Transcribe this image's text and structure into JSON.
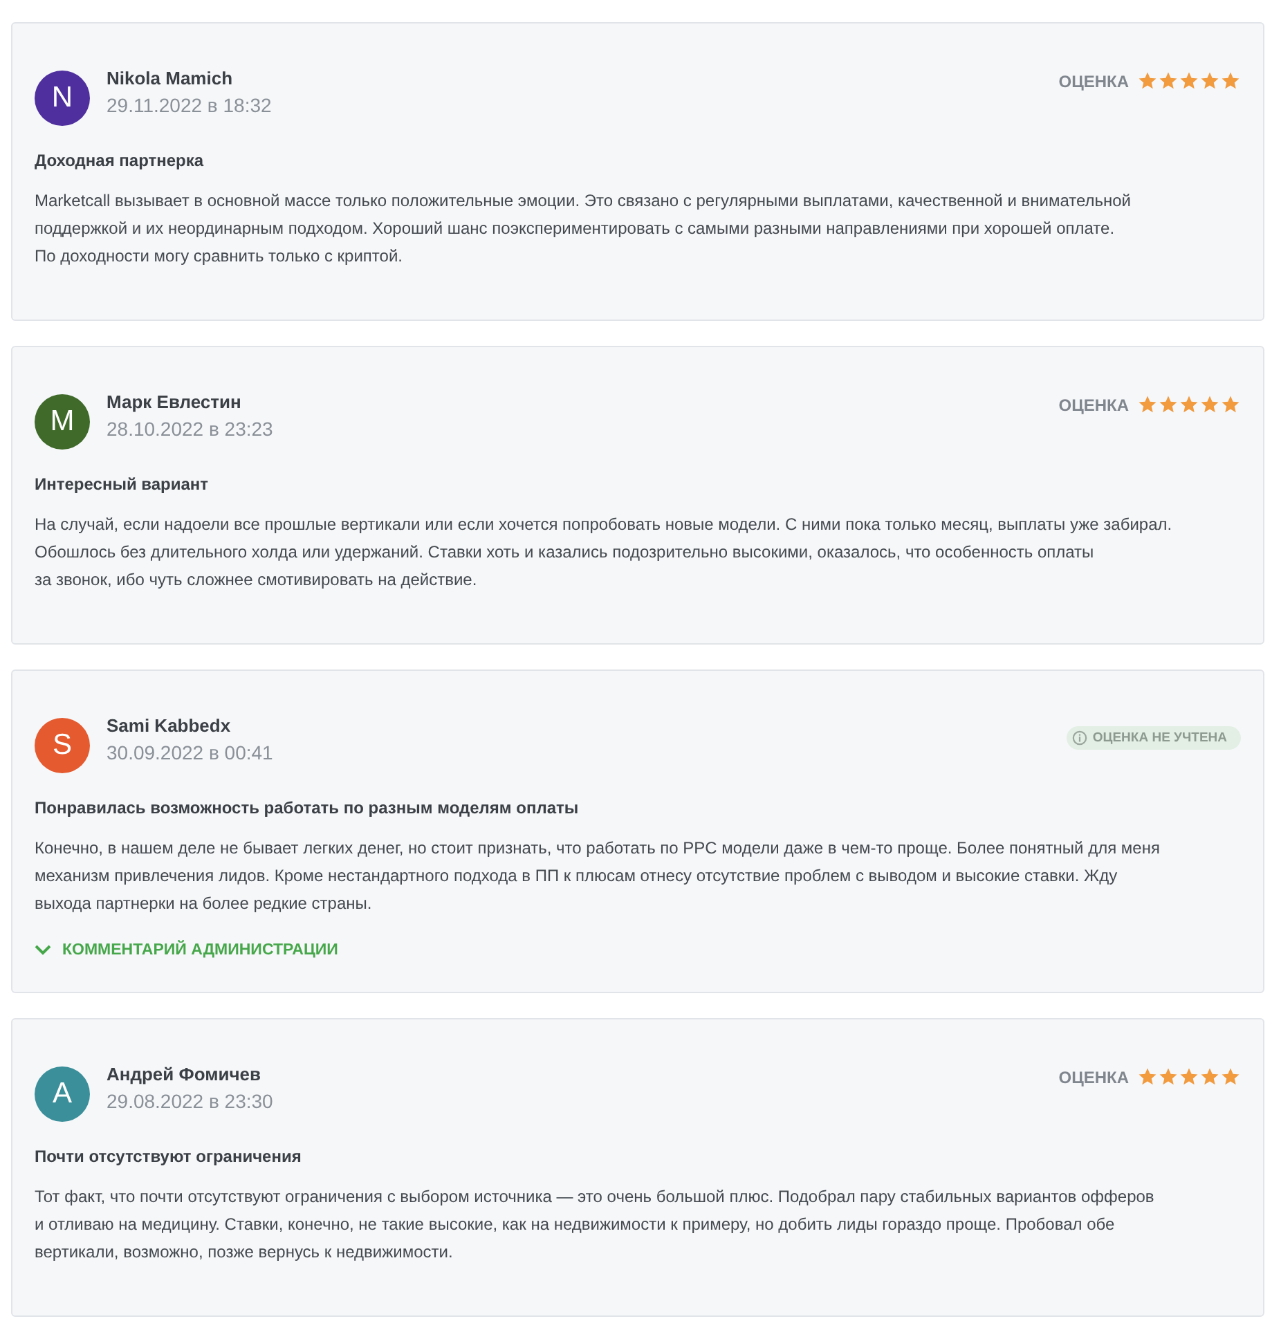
{
  "reviews": [
    {
      "author": "Nikola Mamich",
      "initial": "N",
      "color": "#4f2f9e",
      "date": "29.11.2022 в 18:32",
      "rating": {
        "kind": "stars",
        "label": "ОЦЕНКА",
        "stars": 5
      },
      "title": "Доходная партнерка",
      "lines": [
        "Marketcall вызывает в основной массе только положительные эмоции. Это связано с регулярными выплатами, качественной и внимательной",
        "поддержкой и их неординарным подходом. Хороший шанс поэкспериментировать с самыми разными направлениями при хорошей оплате.",
        "По доходности могу сравнить только с криптой."
      ]
    },
    {
      "author": "Марк Евлестин",
      "initial": "M",
      "color": "#3f6a2a",
      "date": "28.10.2022 в 23:23",
      "rating": {
        "kind": "stars",
        "label": "ОЦЕНКА",
        "stars": 5
      },
      "title": "Интересный вариант",
      "lines": [
        "На случай, если надоели все прошлые вертикали или если хочется попробовать новые модели. С ними пока только месяц, выплаты уже забирал.",
        "Обошлось без длительного холда или удержаний. Ставки хоть и казались подозрительно высокими, оказалось, что особенность оплаты",
        "за звонок, ибо чуть сложнее смотивировать на действие."
      ]
    },
    {
      "author": "Sami Kabbedx",
      "initial": "S",
      "color": "#e55a2f",
      "date": "30.09.2022 в 00:41",
      "rating": {
        "kind": "not_counted",
        "label": "ОЦЕНКА НЕ УЧТЕНА"
      },
      "title": "Понравилась возможность работать по разным моделям оплаты",
      "lines": [
        "Конечно, в нашем деле не бывает легких денег, но стоит признать, что работать по PPC модели даже в чем-то проще. Более понятный для меня",
        "механизм привлечения лидов. Кроме нестандартного подхода в ПП к плюсам отнесу отсутствие проблем с выводом и высокие ставки. Жду",
        "выхода партнерки на более редкие страны."
      ],
      "admin_comment": {
        "label": "КОММЕНТАРИЙ АДМИНИСТРАЦИИ",
        "expanded": false
      }
    },
    {
      "author": "Андрей Фомичев",
      "initial": "A",
      "color": "#3a8f9a",
      "date": "29.08.2022 в 23:30",
      "rating": {
        "kind": "stars",
        "label": "ОЦЕНКА",
        "stars": 5
      },
      "title": "Почти отсутствуют ограничения",
      "lines": [
        "Тот факт, что почти отсутствуют ограничения с выбором источника — это очень большой плюс. Подобрал пару стабильных вариантов офферов",
        "и отливаю на медицину. Ставки, конечно, не такие высокие, как на недвижимости к примеру, но добить лиды гораздо проще. Пробовал обе",
        "вертикали, возможно, позже вернусь к недвижимости."
      ]
    }
  ]
}
